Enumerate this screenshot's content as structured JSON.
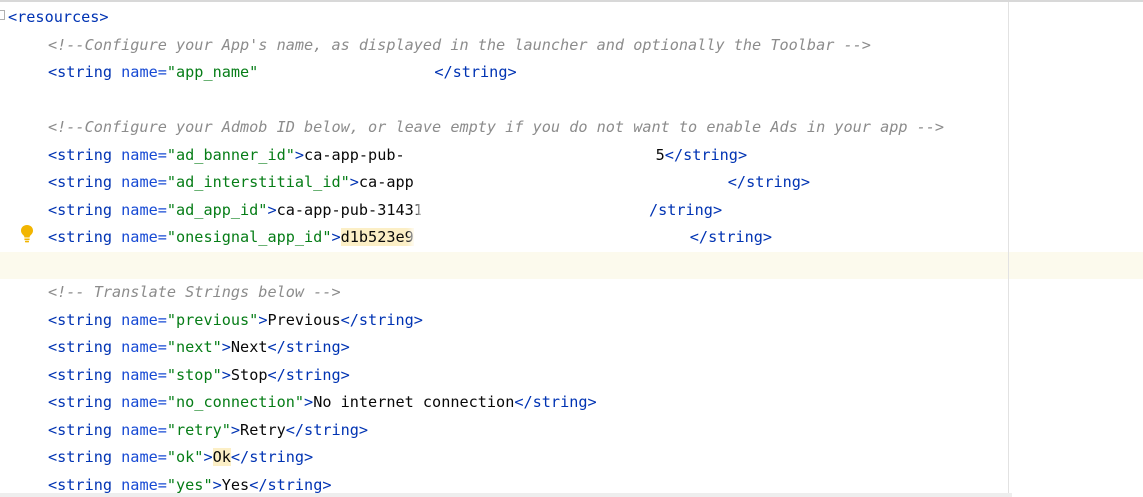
{
  "editor": {
    "lines": [
      {
        "id": "l0",
        "parts": [
          [
            "tag",
            "<resources>"
          ]
        ]
      },
      {
        "id": "l1",
        "parts": [
          [
            "cmt",
            "<!--Configure your App's name, as displayed in the launcher and optionally the Toolbar -->"
          ]
        ]
      },
      {
        "id": "l2",
        "parts": [
          [
            "tag",
            "<string "
          ],
          [
            "attr",
            "name="
          ],
          [
            "val",
            "\"app_name\""
          ],
          [
            "blur",
            ""
          ],
          [
            "tag",
            "</string>"
          ]
        ]
      },
      {
        "id": "l3",
        "parts": []
      },
      {
        "id": "l4",
        "parts": [
          [
            "cmt",
            "<!--Configure your Admob ID below, or leave empty if you do not want to enable Ads in your app -->"
          ]
        ]
      },
      {
        "id": "l5",
        "parts": [
          [
            "tag",
            "<string "
          ],
          [
            "attr",
            "name="
          ],
          [
            "val",
            "\"ad_banner_id\""
          ],
          [
            "tag",
            ">"
          ],
          [
            "txt",
            "ca-app-pub-"
          ],
          [
            "blur",
            ""
          ],
          [
            "txt",
            "5"
          ],
          [
            "tag",
            "</string>"
          ]
        ]
      },
      {
        "id": "l6",
        "parts": [
          [
            "tag",
            "<string "
          ],
          [
            "attr",
            "name="
          ],
          [
            "val",
            "\"ad_interstitial_id\""
          ],
          [
            "tag",
            ">"
          ],
          [
            "txt",
            "ca-app"
          ],
          [
            "blur",
            ""
          ],
          [
            "tag",
            "</string>"
          ]
        ]
      },
      {
        "id": "l7",
        "parts": [
          [
            "tag",
            "<string "
          ],
          [
            "attr",
            "name="
          ],
          [
            "val",
            "\"ad_app_id\""
          ],
          [
            "tag",
            ">"
          ],
          [
            "txt",
            "ca-app-pub-31431"
          ],
          [
            "blur",
            ""
          ],
          [
            "tag",
            "/string>"
          ]
        ]
      },
      {
        "id": "l8",
        "parts": [
          [
            "tag",
            "<string "
          ],
          [
            "attr",
            "name="
          ],
          [
            "val",
            "\"onesignal_app_id\""
          ],
          [
            "tag",
            ">"
          ],
          [
            "hltxt",
            "d1b523e9"
          ],
          [
            "blur",
            ""
          ],
          [
            "tag",
            "</string>"
          ]
        ]
      },
      {
        "id": "l9",
        "parts": []
      },
      {
        "id": "l10",
        "parts": [
          [
            "cmt",
            "<!-- Translate Strings below -->"
          ]
        ]
      },
      {
        "id": "l11",
        "parts": [
          [
            "tag",
            "<string "
          ],
          [
            "attr",
            "name="
          ],
          [
            "val",
            "\"previous\""
          ],
          [
            "tag",
            ">"
          ],
          [
            "txt",
            "Previous"
          ],
          [
            "tag",
            "</string>"
          ]
        ]
      },
      {
        "id": "l12",
        "parts": [
          [
            "tag",
            "<string "
          ],
          [
            "attr",
            "name="
          ],
          [
            "val",
            "\"next\""
          ],
          [
            "tag",
            ">"
          ],
          [
            "txt",
            "Next"
          ],
          [
            "tag",
            "</string>"
          ]
        ]
      },
      {
        "id": "l13",
        "parts": [
          [
            "tag",
            "<string "
          ],
          [
            "attr",
            "name="
          ],
          [
            "val",
            "\"stop\""
          ],
          [
            "tag",
            ">"
          ],
          [
            "txt",
            "Stop"
          ],
          [
            "tag",
            "</string>"
          ]
        ]
      },
      {
        "id": "l14",
        "parts": [
          [
            "tag",
            "<string "
          ],
          [
            "attr",
            "name="
          ],
          [
            "val",
            "\"no_connection\""
          ],
          [
            "tag",
            ">"
          ],
          [
            "txt",
            "No internet connection"
          ],
          [
            "tag",
            "</string>"
          ]
        ]
      },
      {
        "id": "l15",
        "parts": [
          [
            "tag",
            "<string "
          ],
          [
            "attr",
            "name="
          ],
          [
            "val",
            "\"retry\""
          ],
          [
            "tag",
            ">"
          ],
          [
            "txt",
            "Retry"
          ],
          [
            "tag",
            "</string>"
          ]
        ]
      },
      {
        "id": "l16",
        "parts": [
          [
            "tag",
            "<string "
          ],
          [
            "attr",
            "name="
          ],
          [
            "val",
            "\"ok\""
          ],
          [
            "tag",
            ">"
          ],
          [
            "hltxt",
            "Ok"
          ],
          [
            "tag",
            "</string>"
          ]
        ]
      },
      {
        "id": "l17",
        "parts": [
          [
            "tag",
            "<string "
          ],
          [
            "attr",
            "name="
          ],
          [
            "val",
            "\"yes\""
          ],
          [
            "tag",
            ">"
          ],
          [
            "txt",
            "Yes"
          ],
          [
            "tag",
            "</string>"
          ]
        ]
      }
    ]
  },
  "icons": {
    "intention": "lightbulb-icon",
    "fold": "fold-icon"
  },
  "colors": {
    "tag": "#0033b3",
    "attr": "#174ad4",
    "value": "#067d17",
    "text": "#080808",
    "comment": "#8c8c8c",
    "current_line": "#fcfaed",
    "highlight": "#fcefc6",
    "bulb": "#f2b500"
  }
}
